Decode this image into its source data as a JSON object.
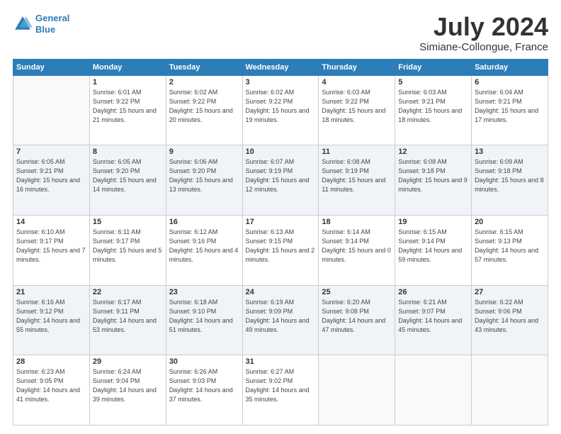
{
  "header": {
    "logo_line1": "General",
    "logo_line2": "Blue",
    "title": "July 2024",
    "subtitle": "Simiane-Collongue, France"
  },
  "weekdays": [
    "Sunday",
    "Monday",
    "Tuesday",
    "Wednesday",
    "Thursday",
    "Friday",
    "Saturday"
  ],
  "weeks": [
    [
      {
        "day": "",
        "sunrise": "",
        "sunset": "",
        "daylight": ""
      },
      {
        "day": "1",
        "sunrise": "Sunrise: 6:01 AM",
        "sunset": "Sunset: 9:22 PM",
        "daylight": "Daylight: 15 hours and 21 minutes."
      },
      {
        "day": "2",
        "sunrise": "Sunrise: 6:02 AM",
        "sunset": "Sunset: 9:22 PM",
        "daylight": "Daylight: 15 hours and 20 minutes."
      },
      {
        "day": "3",
        "sunrise": "Sunrise: 6:02 AM",
        "sunset": "Sunset: 9:22 PM",
        "daylight": "Daylight: 15 hours and 19 minutes."
      },
      {
        "day": "4",
        "sunrise": "Sunrise: 6:03 AM",
        "sunset": "Sunset: 9:22 PM",
        "daylight": "Daylight: 15 hours and 18 minutes."
      },
      {
        "day": "5",
        "sunrise": "Sunrise: 6:03 AM",
        "sunset": "Sunset: 9:21 PM",
        "daylight": "Daylight: 15 hours and 18 minutes."
      },
      {
        "day": "6",
        "sunrise": "Sunrise: 6:04 AM",
        "sunset": "Sunset: 9:21 PM",
        "daylight": "Daylight: 15 hours and 17 minutes."
      }
    ],
    [
      {
        "day": "7",
        "sunrise": "Sunrise: 6:05 AM",
        "sunset": "Sunset: 9:21 PM",
        "daylight": "Daylight: 15 hours and 16 minutes."
      },
      {
        "day": "8",
        "sunrise": "Sunrise: 6:05 AM",
        "sunset": "Sunset: 9:20 PM",
        "daylight": "Daylight: 15 hours and 14 minutes."
      },
      {
        "day": "9",
        "sunrise": "Sunrise: 6:06 AM",
        "sunset": "Sunset: 9:20 PM",
        "daylight": "Daylight: 15 hours and 13 minutes."
      },
      {
        "day": "10",
        "sunrise": "Sunrise: 6:07 AM",
        "sunset": "Sunset: 9:19 PM",
        "daylight": "Daylight: 15 hours and 12 minutes."
      },
      {
        "day": "11",
        "sunrise": "Sunrise: 6:08 AM",
        "sunset": "Sunset: 9:19 PM",
        "daylight": "Daylight: 15 hours and 11 minutes."
      },
      {
        "day": "12",
        "sunrise": "Sunrise: 6:08 AM",
        "sunset": "Sunset: 9:18 PM",
        "daylight": "Daylight: 15 hours and 9 minutes."
      },
      {
        "day": "13",
        "sunrise": "Sunrise: 6:09 AM",
        "sunset": "Sunset: 9:18 PM",
        "daylight": "Daylight: 15 hours and 8 minutes."
      }
    ],
    [
      {
        "day": "14",
        "sunrise": "Sunrise: 6:10 AM",
        "sunset": "Sunset: 9:17 PM",
        "daylight": "Daylight: 15 hours and 7 minutes."
      },
      {
        "day": "15",
        "sunrise": "Sunrise: 6:11 AM",
        "sunset": "Sunset: 9:17 PM",
        "daylight": "Daylight: 15 hours and 5 minutes."
      },
      {
        "day": "16",
        "sunrise": "Sunrise: 6:12 AM",
        "sunset": "Sunset: 9:16 PM",
        "daylight": "Daylight: 15 hours and 4 minutes."
      },
      {
        "day": "17",
        "sunrise": "Sunrise: 6:13 AM",
        "sunset": "Sunset: 9:15 PM",
        "daylight": "Daylight: 15 hours and 2 minutes."
      },
      {
        "day": "18",
        "sunrise": "Sunrise: 6:14 AM",
        "sunset": "Sunset: 9:14 PM",
        "daylight": "Daylight: 15 hours and 0 minutes."
      },
      {
        "day": "19",
        "sunrise": "Sunrise: 6:15 AM",
        "sunset": "Sunset: 9:14 PM",
        "daylight": "Daylight: 14 hours and 59 minutes."
      },
      {
        "day": "20",
        "sunrise": "Sunrise: 6:15 AM",
        "sunset": "Sunset: 9:13 PM",
        "daylight": "Daylight: 14 hours and 57 minutes."
      }
    ],
    [
      {
        "day": "21",
        "sunrise": "Sunrise: 6:16 AM",
        "sunset": "Sunset: 9:12 PM",
        "daylight": "Daylight: 14 hours and 55 minutes."
      },
      {
        "day": "22",
        "sunrise": "Sunrise: 6:17 AM",
        "sunset": "Sunset: 9:11 PM",
        "daylight": "Daylight: 14 hours and 53 minutes."
      },
      {
        "day": "23",
        "sunrise": "Sunrise: 6:18 AM",
        "sunset": "Sunset: 9:10 PM",
        "daylight": "Daylight: 14 hours and 51 minutes."
      },
      {
        "day": "24",
        "sunrise": "Sunrise: 6:19 AM",
        "sunset": "Sunset: 9:09 PM",
        "daylight": "Daylight: 14 hours and 49 minutes."
      },
      {
        "day": "25",
        "sunrise": "Sunrise: 6:20 AM",
        "sunset": "Sunset: 9:08 PM",
        "daylight": "Daylight: 14 hours and 47 minutes."
      },
      {
        "day": "26",
        "sunrise": "Sunrise: 6:21 AM",
        "sunset": "Sunset: 9:07 PM",
        "daylight": "Daylight: 14 hours and 45 minutes."
      },
      {
        "day": "27",
        "sunrise": "Sunrise: 6:22 AM",
        "sunset": "Sunset: 9:06 PM",
        "daylight": "Daylight: 14 hours and 43 minutes."
      }
    ],
    [
      {
        "day": "28",
        "sunrise": "Sunrise: 6:23 AM",
        "sunset": "Sunset: 9:05 PM",
        "daylight": "Daylight: 14 hours and 41 minutes."
      },
      {
        "day": "29",
        "sunrise": "Sunrise: 6:24 AM",
        "sunset": "Sunset: 9:04 PM",
        "daylight": "Daylight: 14 hours and 39 minutes."
      },
      {
        "day": "30",
        "sunrise": "Sunrise: 6:26 AM",
        "sunset": "Sunset: 9:03 PM",
        "daylight": "Daylight: 14 hours and 37 minutes."
      },
      {
        "day": "31",
        "sunrise": "Sunrise: 6:27 AM",
        "sunset": "Sunset: 9:02 PM",
        "daylight": "Daylight: 14 hours and 35 minutes."
      },
      {
        "day": "",
        "sunrise": "",
        "sunset": "",
        "daylight": ""
      },
      {
        "day": "",
        "sunrise": "",
        "sunset": "",
        "daylight": ""
      },
      {
        "day": "",
        "sunrise": "",
        "sunset": "",
        "daylight": ""
      }
    ]
  ]
}
